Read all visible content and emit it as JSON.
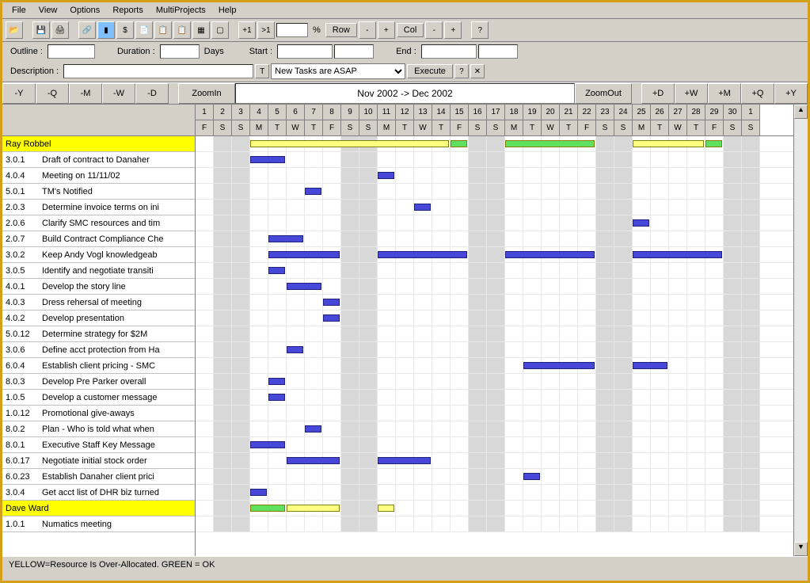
{
  "menu": [
    "File",
    "View",
    "Options",
    "Reports",
    "MultiProjects",
    "Help"
  ],
  "toolbar1": {
    "percent_label": "%",
    "row_label": "Row",
    "col_label": "Col",
    "plus1": "+1",
    "gt1": ">1"
  },
  "form": {
    "outline_label": "Outline :",
    "duration_label": "Duration :",
    "days_label": "Days",
    "start_label": "Start :",
    "end_label": "End :",
    "description_label": "Description :",
    "combo_value": "New Tasks are ASAP",
    "execute_label": "Execute"
  },
  "nav": {
    "minus_y": "-Y",
    "minus_q": "-Q",
    "minus_m": "-M",
    "minus_w": "-W",
    "minus_d": "-D",
    "zoomin": "ZoomIn",
    "range": "Nov 2002 -> Dec 2002",
    "zoomout": "ZoomOut",
    "plus_d": "+D",
    "plus_w": "+W",
    "plus_m": "+M",
    "plus_q": "+Q",
    "plus_y": "+Y"
  },
  "days": {
    "nums": [
      "1",
      "2",
      "3",
      "4",
      "5",
      "6",
      "7",
      "8",
      "9",
      "10",
      "11",
      "12",
      "13",
      "14",
      "15",
      "16",
      "17",
      "18",
      "19",
      "20",
      "21",
      "22",
      "23",
      "24",
      "25",
      "26",
      "27",
      "28",
      "29",
      "30",
      "1"
    ],
    "wk": [
      "F",
      "S",
      "S",
      "M",
      "T",
      "W",
      "T",
      "F",
      "S",
      "S",
      "M",
      "T",
      "W",
      "T",
      "F",
      "S",
      "S",
      "M",
      "T",
      "W",
      "T",
      "F",
      "S",
      "S",
      "M",
      "T",
      "W",
      "T",
      "F",
      "S",
      "S"
    ]
  },
  "weekend_idx": [
    1,
    2,
    8,
    9,
    15,
    16,
    22,
    23,
    29,
    30
  ],
  "resources": [
    {
      "name": "Ray Robbel",
      "alloc": [
        {
          "s": 3,
          "e": 14,
          "state": "over"
        },
        {
          "s": 14,
          "e": 15,
          "state": "ok"
        },
        {
          "s": 17,
          "e": 22,
          "state": "ok"
        },
        {
          "s": 24,
          "e": 28,
          "state": "over"
        },
        {
          "s": 28,
          "e": 29,
          "state": "ok"
        }
      ]
    }
  ],
  "tasks": [
    {
      "id": "3.0.1",
      "name": "Draft of contract to Danaher",
      "bars": [
        {
          "s": 3,
          "e": 5
        }
      ]
    },
    {
      "id": "4.0.4",
      "name": "Meeting on 11/11/02",
      "bars": [
        {
          "s": 10,
          "e": 11
        }
      ]
    },
    {
      "id": "5.0.1",
      "name": "TM's Notified",
      "bars": [
        {
          "s": 6,
          "e": 7
        }
      ]
    },
    {
      "id": "2.0.3",
      "name": "Determine invoice terms on ini",
      "bars": [
        {
          "s": 12,
          "e": 13
        }
      ]
    },
    {
      "id": "2.0.6",
      "name": "Clarify SMC resources and tim",
      "bars": [
        {
          "s": 24,
          "e": 25
        }
      ]
    },
    {
      "id": "2.0.7",
      "name": "Build Contract Compliance Che",
      "bars": [
        {
          "s": 4,
          "e": 6
        }
      ]
    },
    {
      "id": "3.0.2",
      "name": "Keep Andy Vogl knowledgeab",
      "bars": [
        {
          "s": 4,
          "e": 8
        },
        {
          "s": 10,
          "e": 15
        },
        {
          "s": 17,
          "e": 22
        },
        {
          "s": 24,
          "e": 29
        }
      ]
    },
    {
      "id": "3.0.5",
      "name": "Identify and negotiate transiti",
      "bars": [
        {
          "s": 4,
          "e": 5
        }
      ]
    },
    {
      "id": "4.0.1",
      "name": "Develop the story line",
      "bars": [
        {
          "s": 5,
          "e": 7
        }
      ]
    },
    {
      "id": "4.0.3",
      "name": "Dress rehersal of meeting",
      "bars": [
        {
          "s": 7,
          "e": 8
        }
      ]
    },
    {
      "id": "4.0.2",
      "name": "Develop presentation",
      "bars": [
        {
          "s": 7,
          "e": 8
        }
      ]
    },
    {
      "id": "5.0.12",
      "name": "Determine strategy for $2M",
      "bars": []
    },
    {
      "id": "3.0.6",
      "name": "Define acct protection from Ha",
      "bars": [
        {
          "s": 5,
          "e": 6
        }
      ]
    },
    {
      "id": "6.0.4",
      "name": "Establish client pricing - SMC",
      "bars": [
        {
          "s": 18,
          "e": 22
        },
        {
          "s": 24,
          "e": 26
        }
      ]
    },
    {
      "id": "8.0.3",
      "name": "Develop Pre Parker overall",
      "bars": [
        {
          "s": 4,
          "e": 5
        }
      ]
    },
    {
      "id": "1.0.5",
      "name": "Develop a customer message",
      "bars": [
        {
          "s": 4,
          "e": 5
        }
      ]
    },
    {
      "id": "1.0.12",
      "name": "Promotional give-aways",
      "bars": []
    },
    {
      "id": "8.0.2",
      "name": "Plan - Who is told what when",
      "bars": [
        {
          "s": 6,
          "e": 7
        }
      ]
    },
    {
      "id": "8.0.1",
      "name": "Executive Staff Key Message",
      "bars": [
        {
          "s": 3,
          "e": 5
        }
      ]
    },
    {
      "id": "6.0.17",
      "name": "Negotiate initial stock order",
      "bars": [
        {
          "s": 5,
          "e": 8
        },
        {
          "s": 10,
          "e": 13
        }
      ]
    },
    {
      "id": "6.0.23",
      "name": "Establish Danaher client prici",
      "bars": [
        {
          "s": 18,
          "e": 19
        }
      ]
    },
    {
      "id": "3.0.4",
      "name": "Get acct list of DHR biz turned",
      "bars": [
        {
          "s": 3,
          "e": 4
        }
      ]
    }
  ],
  "resources2": [
    {
      "name": "Dave Ward",
      "alloc": [
        {
          "s": 3,
          "e": 5,
          "state": "ok"
        },
        {
          "s": 5,
          "e": 8,
          "state": "over"
        },
        {
          "s": 10,
          "e": 11,
          "state": "over"
        }
      ]
    }
  ],
  "tasks2": [
    {
      "id": "1.0.1",
      "name": "Numatics meeting",
      "bars": []
    }
  ],
  "status": "YELLOW=Resource Is Over-Allocated.  GREEN = OK"
}
